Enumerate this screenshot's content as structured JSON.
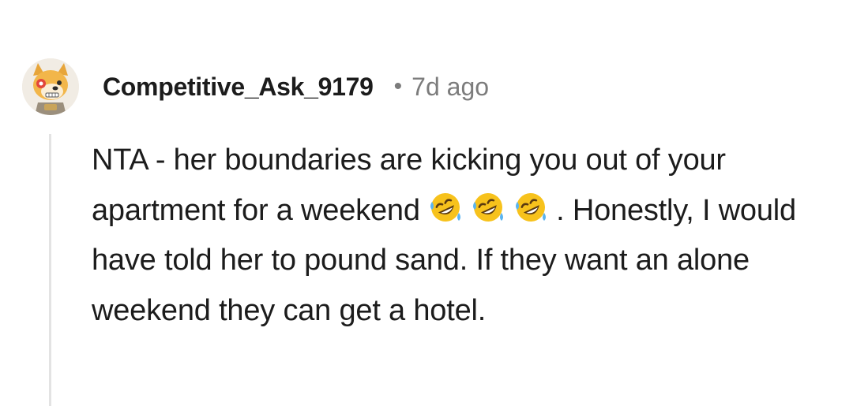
{
  "comment": {
    "author": "Competitive_Ask_9179",
    "separator": "•",
    "age": "7d ago",
    "body_before_emoji": "NTA - her boundaries are kicking you out of your apartment for a weekend ",
    "emojis": [
      "rolling-on-floor-laughing",
      "rolling-on-floor-laughing",
      "rolling-on-floor-laughing"
    ],
    "body_after_emoji": ". Honestly, I would have told her to pound sand. If they want an alone weekend they can get a hotel."
  },
  "colors": {
    "text": "#1c1c1c",
    "meta": "#7c7c7c",
    "thread_line": "#e3e3e3",
    "emoji_face": "#f7c21c",
    "emoji_tear": "#5ab4f0"
  }
}
